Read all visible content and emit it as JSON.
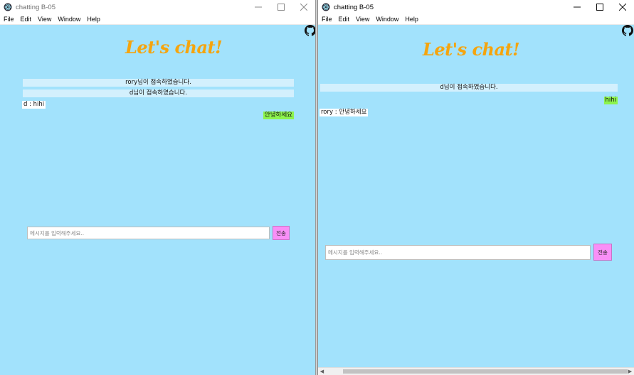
{
  "left_window": {
    "title": "chatting B-05",
    "menu": [
      "File",
      "Edit",
      "View",
      "Window",
      "Help"
    ],
    "logo": "Let's chat!",
    "notices": [
      "rory님이 접속하였습니다.",
      "d님이 접속하였습니다."
    ],
    "incoming": [
      "d : hihi"
    ],
    "outgoing": [
      "안녕하세요"
    ],
    "input": {
      "value": "",
      "placeholder": "메시지를 입력해주세요.."
    },
    "send_label": "전송"
  },
  "right_window": {
    "title": "chatting B-05",
    "menu": [
      "File",
      "Edit",
      "View",
      "Window",
      "Help"
    ],
    "logo": "Let's chat!",
    "notices": [
      "d님이 접속하였습니다."
    ],
    "incoming": [
      "rory : 안녕하세요"
    ],
    "outgoing": [
      "hihi"
    ],
    "input": {
      "value": "",
      "placeholder": "메시지를 입력해주세요.."
    },
    "send_label": "전송",
    "scroll_arrows": [
      "◀",
      "▶"
    ]
  },
  "icons": {
    "app": "electron-app-icon",
    "minimize": "minimize-icon",
    "maximize": "maximize-icon",
    "close": "close-icon",
    "github": "github-icon"
  },
  "colors": {
    "background": "#a2e2fc",
    "notice": "#d3f0fd",
    "outgoing": "#8df44d",
    "send_button": "#f98ff7",
    "logo": "#f5a40d"
  }
}
